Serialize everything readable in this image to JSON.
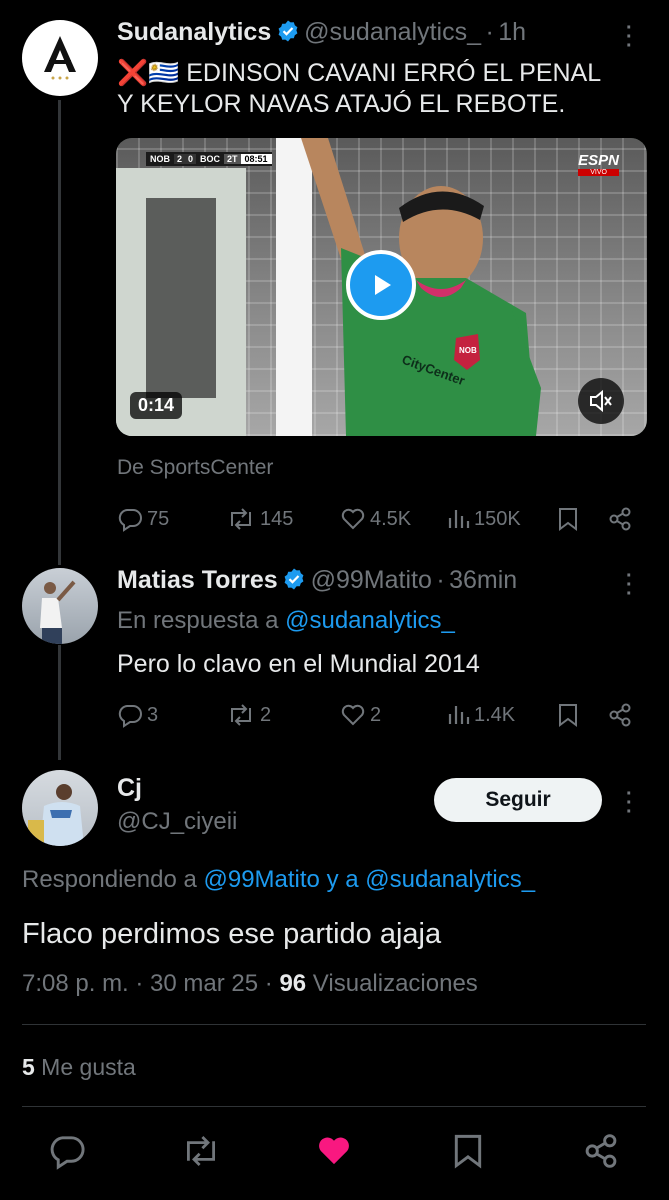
{
  "tweet1": {
    "name": "Sudanalytics",
    "handle": "@sudanalytics_",
    "sep": "·",
    "time": "1h",
    "flags": "❌🇺🇾",
    "text_line1": "EDINSON CAVANI ERRÓ EL PENAL",
    "text_line2": "Y KEYLOR NAVAS ATAJÓ EL REBOTE.",
    "video": {
      "duration": "0:14",
      "scoreboard": {
        "home": "NOB",
        "home_score": "2",
        "away_score": "0",
        "away": "BOC",
        "period": "2T",
        "clock": "08:51"
      },
      "broadcaster": "ESPN",
      "live_label": "VIVO",
      "jersey_sponsor": "CityCenter",
      "crest_label": "NOB"
    },
    "source": "De SportsCenter",
    "stats": {
      "replies": "75",
      "reposts": "145",
      "likes": "4.5K",
      "views": "150K"
    }
  },
  "tweet2": {
    "name": "Matias Torres",
    "handle": "@99Matito",
    "sep": "·",
    "time": "36min",
    "reply_prefix": "En respuesta a ",
    "reply_to": "@sudanalytics_",
    "text": "Pero lo clavo en el Mundial 2014",
    "stats": {
      "replies": "3",
      "reposts": "2",
      "likes": "2",
      "views": "1.4K"
    }
  },
  "main": {
    "name": "Cj",
    "handle": "@CJ_ciyeii",
    "follow_label": "Seguir",
    "replying_prefix": "Respondiendo a ",
    "replying_user1": "@99Matito",
    "replying_join": " y a ",
    "replying_user2": "@sudanalytics_",
    "text": "Flaco perdimos ese partido ajaja",
    "meta_time": "7:08 p. m. · 30 mar 25 · ",
    "meta_views_count": "96",
    "meta_views_label": " Visualizaciones",
    "likes_count": "5",
    "likes_label": " Me gusta"
  },
  "colors": {
    "accent": "#1d9bf0",
    "like_active": "#f91880",
    "muted": "#71767b",
    "text": "#e7e9ea",
    "background": "#000000"
  }
}
